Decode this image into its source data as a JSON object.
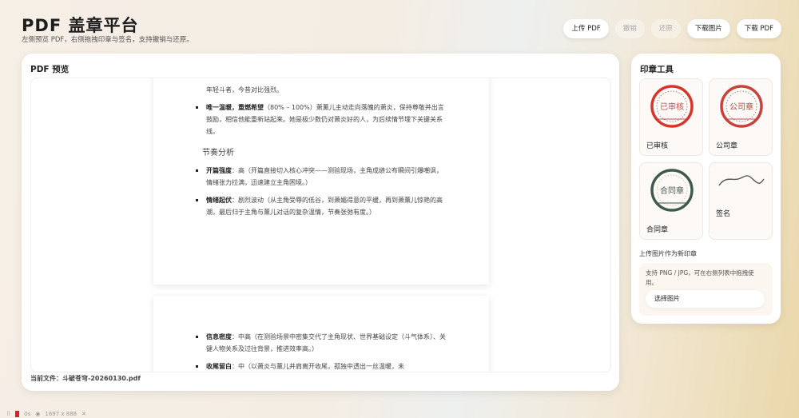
{
  "header": {
    "title": "PDF 盖章平台",
    "subtitle": "左侧预览 PDF，右侧拖拽印章与签名，支持撤销与还原。"
  },
  "toolbar": {
    "upload_pdf": "上传 PDF",
    "undo": "撤销",
    "redo": "还原",
    "download_image": "下载图片",
    "download_pdf": "下载 PDF"
  },
  "preview": {
    "title": "PDF 预览",
    "current_file": "当前文件：斗破苍穹-20260130.pdf",
    "page1": {
      "item0_tail": "年轻斗者，今昔对比强烈。",
      "item1_bold": "唯一温暖，重燃希望",
      "item1_text": "（80% – 100%）萧薰儿主动走向落魄的萧炎，保持尊敬并出言鼓励，相信他能重新站起来。她是极少数仍对萧炎好的人，为后续情节埋下关键关系线。",
      "section": "节奏分析",
      "item2_bold": "开篇强度",
      "item2_text": "：高（开篇直接切入核心冲突——测验现场，主角成绩公布瞬间引爆嘲讽，情绪张力拉满，迅速建立主角困境。）",
      "item3_bold": "情绪起伏",
      "item3_text": "：剧烈波动（从主角受辱的低谷，到萧媚得意的平缓，再到萧薰儿惊艳的高潮，最后归于主角与薰儿对话的复杂温情，节奏张弛有度。）"
    },
    "page2": {
      "item1_bold": "信息密度",
      "item1_text": "：中高（在测验场景中密集交代了主角现状、世界基础设定（斗气体系）、关键人物关系及过往背景，推进效率高。）",
      "item2_bold": "收尾留白",
      "item2_text": "：中（以萧炎与薰儿并肩离开收尾，孤独中透出一丝温暖，未"
    }
  },
  "tools": {
    "title": "印章工具",
    "stamps": [
      {
        "label": "已审核",
        "text": "已审核",
        "color": "#d9342b"
      },
      {
        "label": "公司章",
        "text": "公司章",
        "color": "#c8423b"
      },
      {
        "label": "合同章",
        "text": "合同章",
        "color": "#3e5a4c"
      },
      {
        "label": "签名"
      }
    ],
    "upload_heading": "上传图片作为新印章",
    "upload_desc": "支持 PNG / JPG，可在右侧列表中拖拽使用。",
    "choose_image": "选择图片"
  },
  "statusbar": {
    "time": "0s",
    "size": "1697 x 888"
  }
}
